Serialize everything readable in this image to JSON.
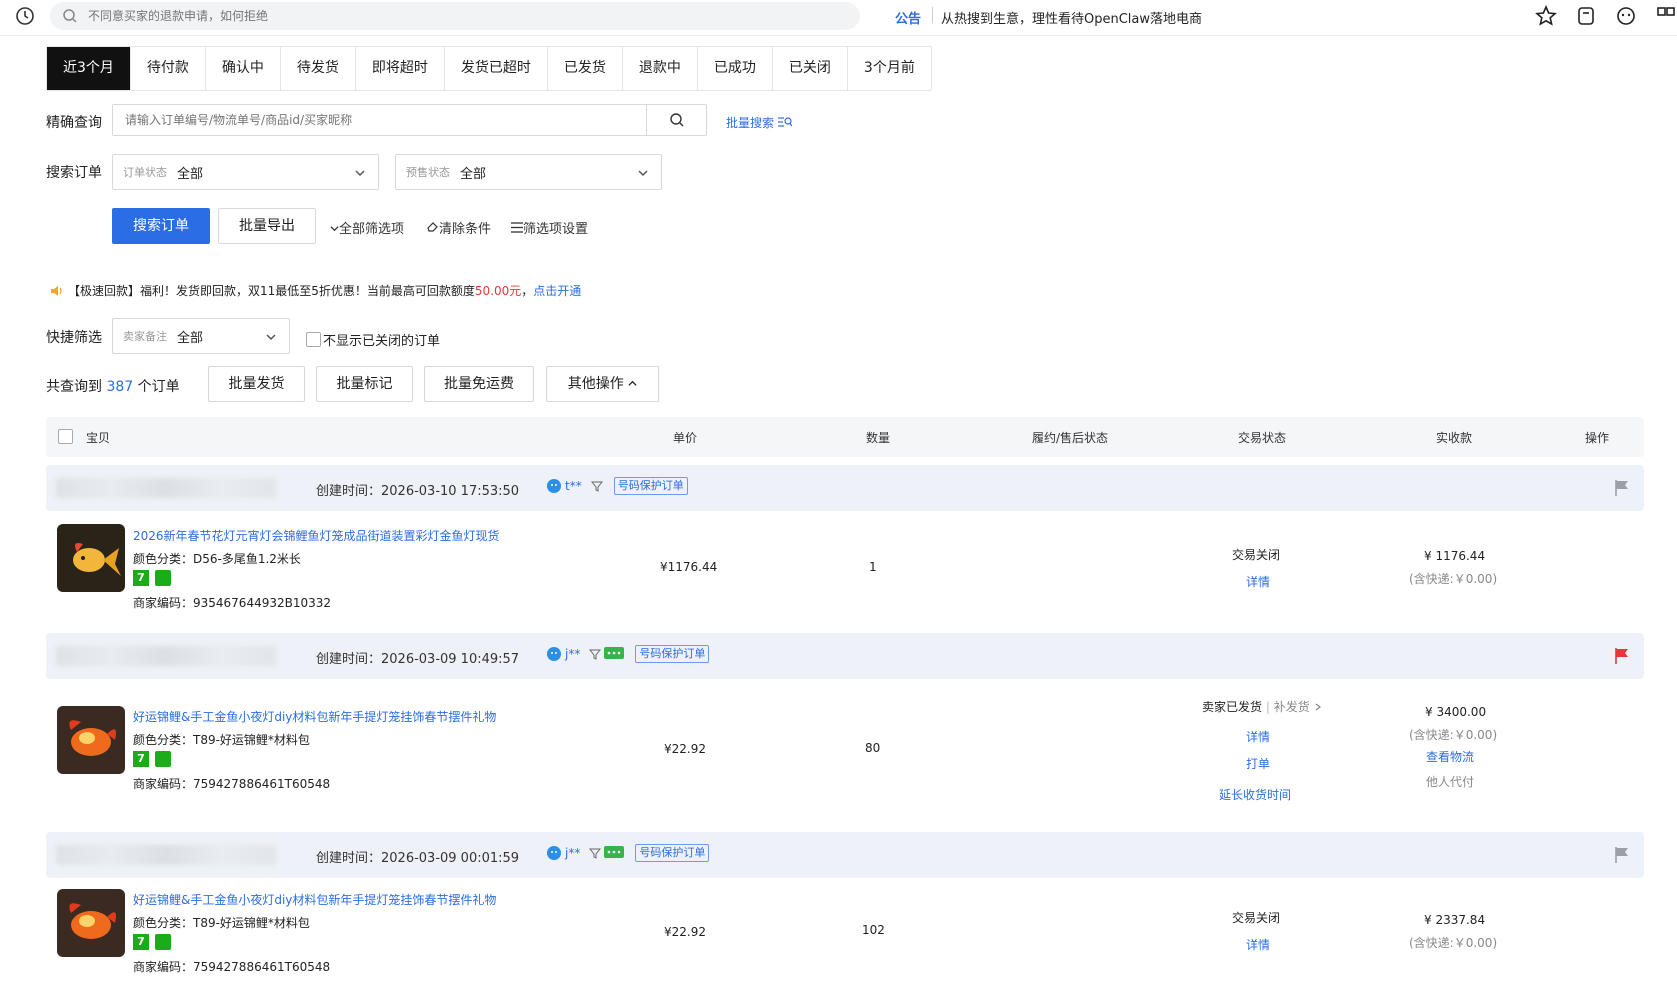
{
  "topbar": {
    "search_placeholder": "不同意买家的退款申请，如何拒绝",
    "announce_label": "公告",
    "announce_text": "从热搜到生意，理性看待OpenClaw落地电商"
  },
  "tabs": [
    {
      "label": "近3个月"
    },
    {
      "label": "待付款"
    },
    {
      "label": "确认中"
    },
    {
      "label": "待发货"
    },
    {
      "label": "即将超时"
    },
    {
      "label": "发货已超时"
    },
    {
      "label": "已发货"
    },
    {
      "label": "退款中"
    },
    {
      "label": "已成功"
    },
    {
      "label": "已关闭"
    },
    {
      "label": "3个月前"
    }
  ],
  "query": {
    "label": "精确查询",
    "placeholder": "请输入订单编号/物流单号/商品id/买家昵称",
    "batch_search": "批量搜索"
  },
  "search_orders": {
    "label": "搜索订单",
    "order_status_label": "订单状态",
    "order_status_value": "全部",
    "presale_label": "预售状态",
    "presale_value": "全部"
  },
  "actions": {
    "search_btn": "搜索订单",
    "export_btn": "批量导出",
    "all_filters": "全部筛选项",
    "clear": "清除条件",
    "filter_settings": "筛选项设置"
  },
  "promo": {
    "prefix": "【极速回款】福利！发货即回款，双11最低至5折优惠！当前最高可回款额度",
    "amount": "50.00元",
    "comma": "，",
    "link": "点击开通"
  },
  "quick": {
    "label": "快捷筛选",
    "remark_label": "卖家备注",
    "remark_value": "全部",
    "hide_closed": "不显示已关闭的订单"
  },
  "summary": {
    "prefix": "共查询到",
    "count": "387",
    "suffix": "个订单",
    "batch_ship": "批量发货",
    "batch_mark": "批量标记",
    "batch_free": "批量免运费",
    "other_ops": "其他操作"
  },
  "table_headers": {
    "item": "宝贝",
    "price": "单价",
    "qty": "数量",
    "after_sale": "履约/售后状态",
    "trade_status": "交易状态",
    "paid": "实收款",
    "ops": "操作"
  },
  "orders": [
    {
      "create_time": "创建时间：2026-03-10 17:53:50",
      "buyer": "t**",
      "protect": "号码保护订单",
      "flag_color": "#9aa0a6",
      "title": "2026新年春节花灯元宵灯会锦鲤鱼灯笼成品街道装置彩灯金鱼灯现货",
      "sku": "颜色分类：D56-多尾鱼1.2米长",
      "code": "商家编码：935467644932B10332",
      "price": "¥1176.44",
      "qty": "1",
      "status": "交易关闭",
      "detail": "详情",
      "paid": "¥ 1176.44",
      "shipping": "(含快递:￥0.00)"
    },
    {
      "create_time": "创建时间：2026-03-09 10:49:57",
      "buyer": "j**",
      "protect": "号码保护订单",
      "flag_color": "#e4393c",
      "title": "好运锦鲤&手工金鱼小夜灯diy材料包新年手提灯笼挂饰春节摆件礼物",
      "sku": "颜色分类：T89-好运锦鲤*材料包",
      "code": "商家编码：759427886461T60548",
      "price": "¥22.92",
      "qty": "80",
      "status": "卖家已发货",
      "status_sep": "|",
      "status_extra": "补发货",
      "detail": "详情",
      "print": "打单",
      "extend": "延长收货时间",
      "paid": "¥ 3400.00",
      "shipping": "(含快递:￥0.00)",
      "logistics": "查看物流",
      "proxy": "他人代付"
    },
    {
      "create_time": "创建时间：2026-03-09 00:01:59",
      "buyer": "j**",
      "protect": "号码保护订单",
      "flag_color": "#9aa0a6",
      "title": "好运锦鲤&手工金鱼小夜灯diy材料包新年手提灯笼挂饰春节摆件礼物",
      "sku": "颜色分类：T89-好运锦鲤*材料包",
      "code": "商家编码：759427886461T60548",
      "price": "¥22.92",
      "qty": "102",
      "status": "交易关闭",
      "detail": "详情",
      "paid": "¥ 2337.84",
      "shipping": "(含快递:￥0.00)"
    }
  ]
}
